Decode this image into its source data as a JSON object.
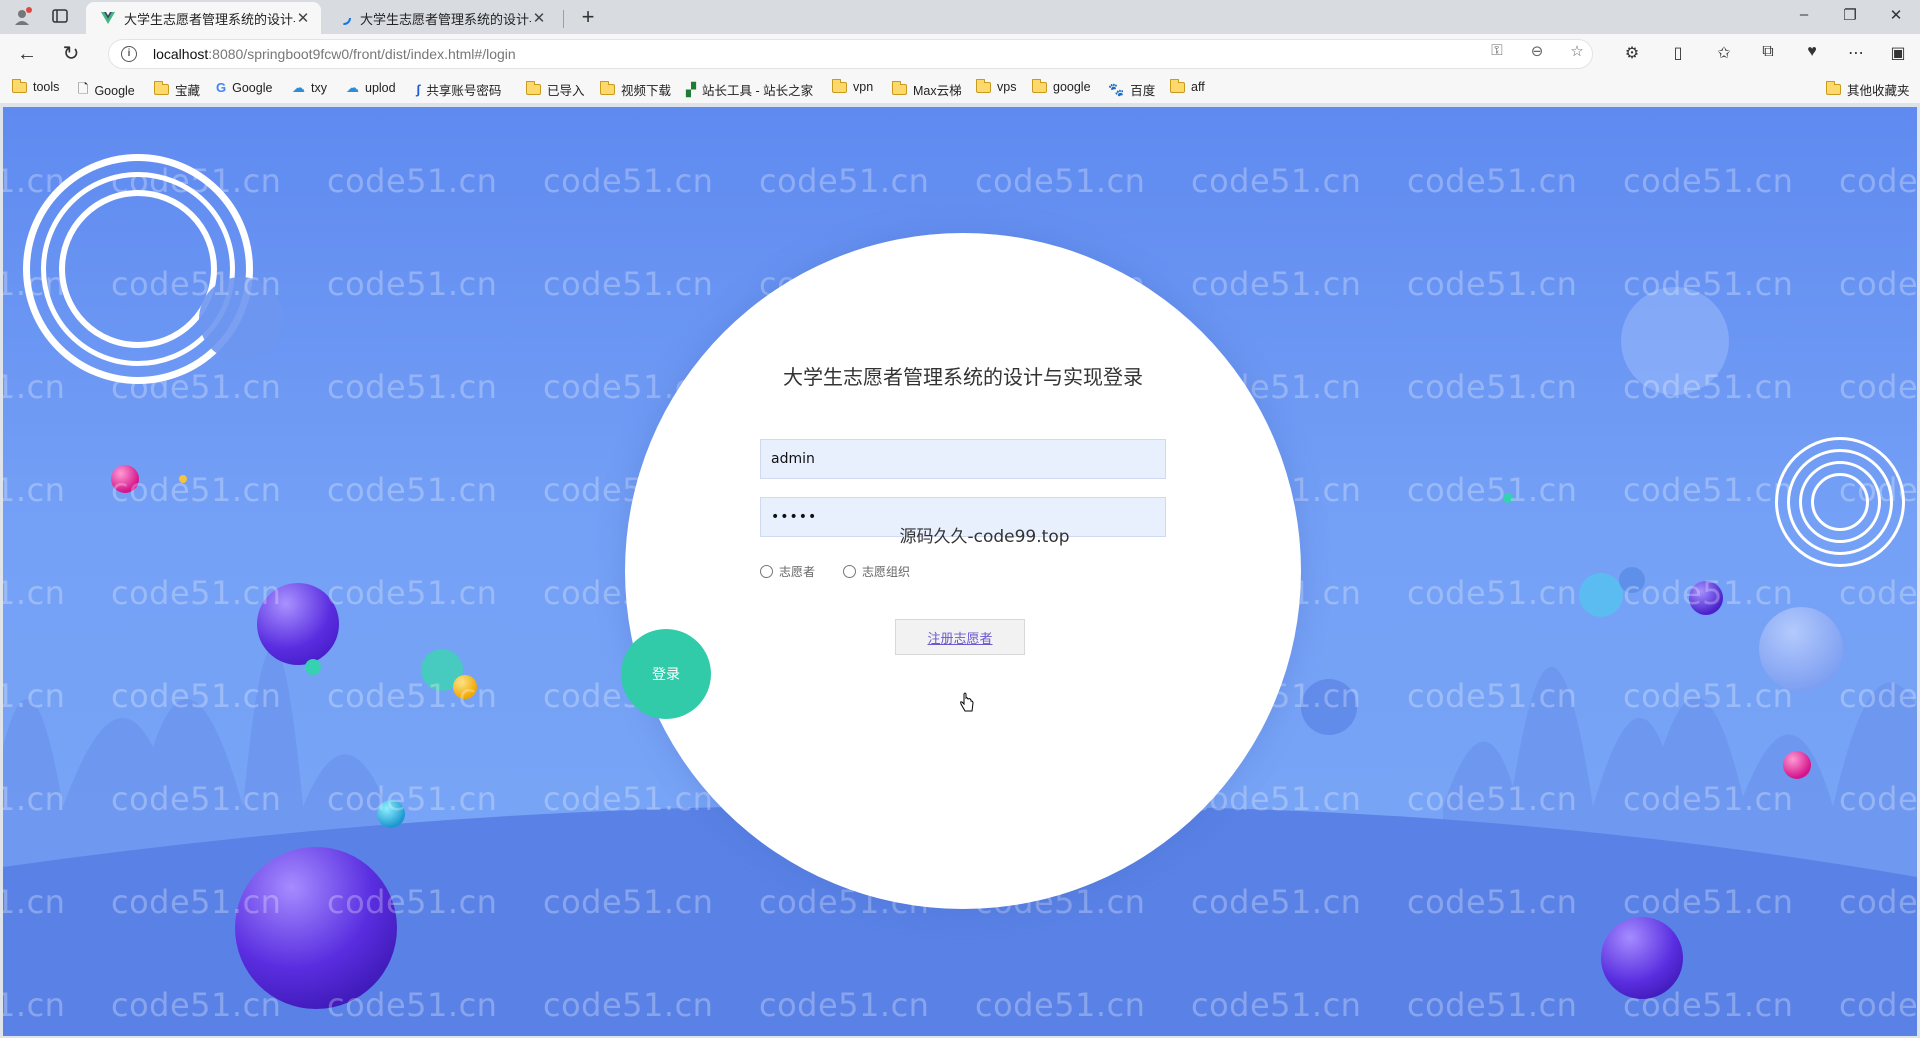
{
  "browser": {
    "tabs": [
      {
        "title": "大学生志愿者管理系统的设计与实现",
        "active": true
      },
      {
        "title": "大学生志愿者管理系统的设计与实现",
        "active": false
      }
    ],
    "address": {
      "host": "localhost",
      "path": ":8080/springboot9fcw0/front/dist/index.html#/login"
    },
    "bookmarks": [
      {
        "label": "tools",
        "icon": "folder-icon"
      },
      {
        "label": "Google",
        "icon": "page-icon"
      },
      {
        "label": "宝藏",
        "icon": "folder-icon"
      },
      {
        "label": "Google",
        "icon": "google-icon"
      },
      {
        "label": "txy",
        "icon": "cloud-icon"
      },
      {
        "label": "uplod",
        "icon": "cloud-icon"
      },
      {
        "label": "共享账号密码",
        "icon": "site-icon"
      },
      {
        "label": "已导入",
        "icon": "folder-icon"
      },
      {
        "label": "视频下载",
        "icon": "folder-icon"
      },
      {
        "label": "站长工具 - 站长之家",
        "icon": "site-icon"
      },
      {
        "label": "vpn",
        "icon": "folder-icon"
      },
      {
        "label": "Max云梯",
        "icon": "folder-icon"
      },
      {
        "label": "vps",
        "icon": "folder-icon"
      },
      {
        "label": "google",
        "icon": "folder-icon"
      },
      {
        "label": "百度",
        "icon": "baidu-icon"
      },
      {
        "label": "aff",
        "icon": "folder-icon"
      }
    ],
    "other_bookmarks": "其他收藏夹"
  },
  "login": {
    "title": "大学生志愿者管理系统的设计与实现登录",
    "username_value": "admin",
    "password_value": "•••••",
    "overlay_text": "源码久久-code99.top",
    "roles": [
      "志愿者",
      "志愿组织"
    ],
    "register_label": "注册志愿者",
    "login_label": "登录"
  },
  "watermark_text": "code51.cn",
  "colors": {
    "background": "#6f9bf5",
    "login_button": "#32cba9",
    "register_link": "#6a5acd"
  }
}
